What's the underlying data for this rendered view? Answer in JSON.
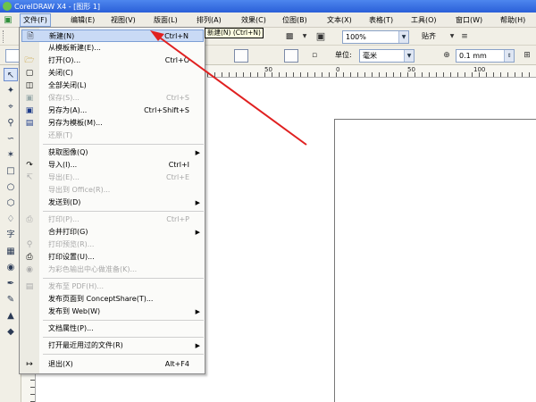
{
  "window": {
    "title": "CorelDRAW X4 - [图形 1]"
  },
  "menubar": [
    "文件(F)",
    "编辑(E)",
    "视图(V)",
    "版面(L)",
    "排列(A)",
    "效果(C)",
    "位图(B)",
    "文本(X)",
    "表格(T)",
    "工具(O)",
    "窗口(W)",
    "帮助(H)"
  ],
  "toolbar": {
    "zoom_value": "100%",
    "snap_label": "贴齐",
    "unit_label": "单位:",
    "unit_value": "毫米",
    "nudge_value": "0.1 mm"
  },
  "tooltip": "新建(N) (Ctrl+N)",
  "ruler": {
    "labels": [
      "50",
      "0",
      "50",
      "100"
    ]
  },
  "file_menu": {
    "items": [
      {
        "label": "新建(N)",
        "shortcut": "Ctrl+N",
        "icon": "new-doc-icon",
        "state": "highlighted"
      },
      {
        "label": "从模板新建(E)...",
        "shortcut": "",
        "icon": "",
        "state": "enabled"
      },
      {
        "label": "打开(O)...",
        "shortcut": "Ctrl+O",
        "icon": "open-folder-icon",
        "state": "enabled"
      },
      {
        "label": "关闭(C)",
        "shortcut": "",
        "icon": "close-doc-icon",
        "state": "enabled"
      },
      {
        "label": "全部关闭(L)",
        "shortcut": "",
        "icon": "close-all-icon",
        "state": "enabled"
      },
      {
        "label": "保存(S)...",
        "shortcut": "Ctrl+S",
        "icon": "save-icon",
        "state": "disabled"
      },
      {
        "label": "另存为(A)...",
        "shortcut": "Ctrl+Shift+S",
        "icon": "save-as-icon",
        "state": "enabled"
      },
      {
        "label": "另存为模板(M)...",
        "shortcut": "",
        "icon": "save-template-icon",
        "state": "enabled"
      },
      {
        "label": "还原(T)",
        "shortcut": "",
        "icon": "",
        "state": "disabled"
      },
      {
        "label": "获取图像(Q)",
        "shortcut": "",
        "icon": "",
        "state": "submenu"
      },
      {
        "label": "导入(I)...",
        "shortcut": "Ctrl+I",
        "icon": "import-icon",
        "state": "enabled"
      },
      {
        "label": "导出(E)...",
        "shortcut": "Ctrl+E",
        "icon": "export-icon",
        "state": "disabled"
      },
      {
        "label": "导出到 Office(R)...",
        "shortcut": "",
        "icon": "",
        "state": "disabled"
      },
      {
        "label": "发送到(D)",
        "shortcut": "",
        "icon": "",
        "state": "submenu"
      },
      {
        "label": "打印(P)...",
        "shortcut": "Ctrl+P",
        "icon": "print-icon",
        "state": "disabled"
      },
      {
        "label": "合并打印(G)",
        "shortcut": "",
        "icon": "",
        "state": "submenu"
      },
      {
        "label": "打印预览(R)...",
        "shortcut": "",
        "icon": "print-preview-icon",
        "state": "disabled"
      },
      {
        "label": "打印设置(U)...",
        "shortcut": "",
        "icon": "print-setup-icon",
        "state": "enabled"
      },
      {
        "label": "为彩色输出中心做准备(K)...",
        "shortcut": "",
        "icon": "color-output-icon",
        "state": "disabled"
      },
      {
        "label": "发布至 PDF(H)...",
        "shortcut": "",
        "icon": "pdf-icon",
        "state": "disabled"
      },
      {
        "label": "发布页面到 ConceptShare(T)...",
        "shortcut": "",
        "icon": "",
        "state": "enabled"
      },
      {
        "label": "发布到 Web(W)",
        "shortcut": "",
        "icon": "",
        "state": "submenu"
      },
      {
        "label": "文档属性(P)...",
        "shortcut": "",
        "icon": "",
        "state": "enabled"
      },
      {
        "label": "打开最近用过的文件(R)",
        "shortcut": "",
        "icon": "",
        "state": "submenu"
      },
      {
        "label": "退出(X)",
        "shortcut": "Alt+F4",
        "icon": "exit-icon",
        "state": "enabled"
      }
    ]
  },
  "colors": {
    "annotation_arrow": "#e02020",
    "title_bar": "#2a5fd8",
    "menu_highlight": "#c9daf5"
  }
}
